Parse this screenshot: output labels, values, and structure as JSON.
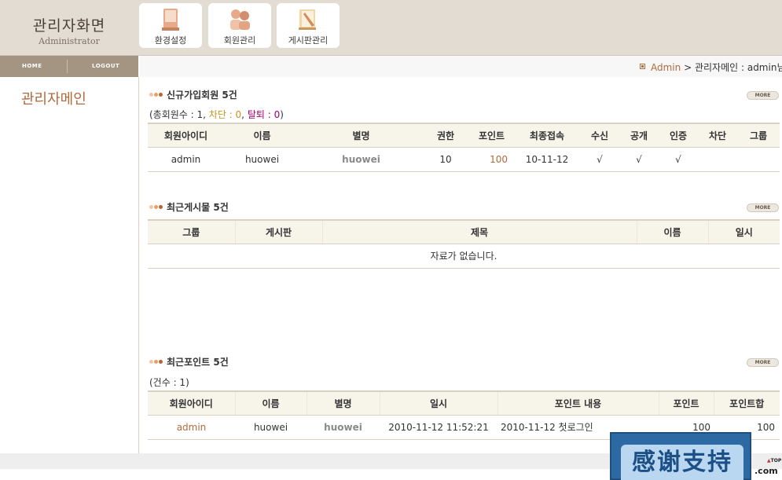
{
  "header": {
    "title": "관리자화면",
    "subtitle": "Administrator",
    "menu": [
      {
        "label": "환경설정",
        "icon": "settings-book-icon"
      },
      {
        "label": "회원관리",
        "icon": "members-icon"
      },
      {
        "label": "게시판관리",
        "icon": "board-icon"
      }
    ]
  },
  "topnav": {
    "home": "HOME",
    "logout": "LOGOUT"
  },
  "sidebar": {
    "title": "관리자메인"
  },
  "breadcrumb": {
    "root": "Admin",
    "sep": ">",
    "rest": "관리자메인 : admin님"
  },
  "more_label": "MORE",
  "members": {
    "title": "신규가입회원 5건",
    "summary": {
      "prefix": "(총회원수 : 1, ",
      "blocked": "차단 : 0",
      "comma": ", ",
      "left": "탈퇴 : 0",
      "suffix": ")"
    },
    "columns": [
      "회원아이디",
      "이름",
      "별명",
      "권한",
      "포인트",
      "최종접속",
      "수신",
      "공개",
      "인증",
      "차단",
      "그룹"
    ],
    "rows": [
      {
        "id": "admin",
        "name": "huowei",
        "nick": "huowei",
        "level": "10",
        "point": "100",
        "last": "10-11-12",
        "recv": "√",
        "open": "√",
        "cert": "√",
        "block": "",
        "group": ""
      }
    ]
  },
  "posts": {
    "title": "최근게시물 5건",
    "columns": [
      "그룹",
      "게시판",
      "제목",
      "이름",
      "일시"
    ],
    "empty": "자료가 없습니다."
  },
  "points": {
    "title": "최근포인트 5건",
    "summary": "(건수 : 1)",
    "columns": [
      "회원아이디",
      "이름",
      "별명",
      "일시",
      "포인트 내용",
      "포인트",
      "포인트합"
    ],
    "rows": [
      {
        "id": "admin",
        "name": "huowei",
        "nick": "huowei",
        "date": "2010-11-12 11:52:21",
        "content": "2010-11-12 첫로그인",
        "point": "100",
        "sum": "100"
      }
    ]
  },
  "banner": {
    "text": "感谢支持",
    "suffix": ".com",
    "top": "TOP"
  },
  "colors": {
    "accent": "#b26a3c",
    "header_bg": "#e3dcd3",
    "nav_bg": "#a39581",
    "table_head": "#f7f4ea"
  }
}
